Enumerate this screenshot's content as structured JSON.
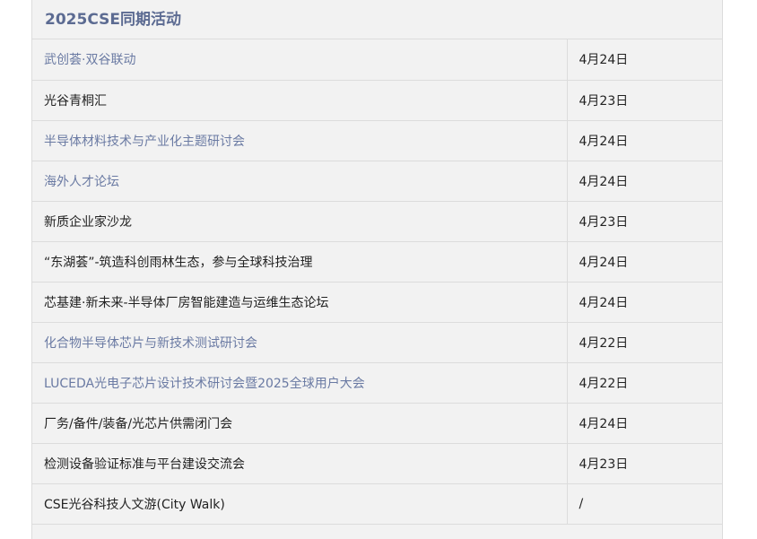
{
  "section": {
    "title": "2025CSE同期活动"
  },
  "events": [
    {
      "name": "武创荟·双谷联动",
      "date": "4月24日",
      "is_link": true
    },
    {
      "name": "光谷青桐汇",
      "date": "4月23日",
      "is_link": false
    },
    {
      "name": "半导体材料技术与产业化主题研讨会",
      "date": "4月24日",
      "is_link": true
    },
    {
      "name": "海外人才论坛",
      "date": "4月24日",
      "is_link": true
    },
    {
      "name": "新质企业家沙龙",
      "date": "4月23日",
      "is_link": false
    },
    {
      "name": "“东湖荟”-筑造科创雨林生态，参与全球科技治理",
      "date": "4月24日",
      "is_link": false
    },
    {
      "name": "芯基建·新未来-半导体厂房智能建造与运维生态论坛",
      "date": "4月24日",
      "is_link": false
    },
    {
      "name": "化合物半导体芯片与新技术测试研讨会",
      "date": "4月22日",
      "is_link": true
    },
    {
      "name": "LUCEDA光电子芯片设计技术研讨会暨2025全球用户大会",
      "date": "4月22日",
      "is_link": true
    },
    {
      "name": "厂务/备件/装备/光芯片供需闭门会",
      "date": "4月24日",
      "is_link": false
    },
    {
      "name": "检测设备验证标准与平台建设交流会",
      "date": "4月23日",
      "is_link": false
    },
    {
      "name": "CSE光谷科技人文游(City Walk)",
      "date": "/",
      "is_link": false
    }
  ],
  "colors": {
    "title": "#5c6b92",
    "link_text": "#6a7aa3",
    "plain_text": "#222222",
    "panel_background": "#f2f2f2",
    "border": "#dcdcdc"
  }
}
